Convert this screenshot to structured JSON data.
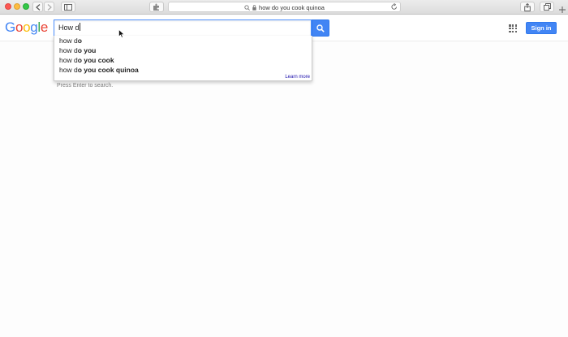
{
  "browser": {
    "address_text": "how do you cook quinoa",
    "icons": [
      "back-icon",
      "forward-icon",
      "sidebar-icon",
      "extension-icon",
      "search-icon",
      "lock-icon",
      "reload-icon",
      "share-icon",
      "tabs-icon",
      "new-tab-icon"
    ]
  },
  "google": {
    "logo_letters": [
      "G",
      "o",
      "o",
      "g",
      "l",
      "e"
    ],
    "logo_colors": [
      "#4285f4",
      "#ea4335",
      "#fbbc05",
      "#4285f4",
      "#34a853",
      "#ea4335"
    ],
    "search_value": "How d",
    "signin_label": "Sign in",
    "accent": "#4285f4"
  },
  "suggestions": {
    "items": [
      {
        "prefix": "how d",
        "bold": "o"
      },
      {
        "prefix": "how d",
        "bold": "o you"
      },
      {
        "prefix": "how d",
        "bold": "o you cook"
      },
      {
        "prefix": "how d",
        "bold": "o you cook quinoa"
      }
    ],
    "learn_more": "Learn more"
  },
  "hint_text": "Press Enter to search."
}
